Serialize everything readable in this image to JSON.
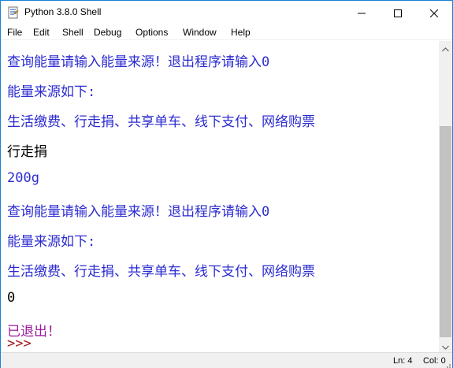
{
  "window": {
    "title": "Python 3.8.0 Shell"
  },
  "menu": {
    "items": [
      "File",
      "Edit",
      "Shell",
      "Debug",
      "Options",
      "Window",
      "Help"
    ]
  },
  "shell": {
    "lines": [
      {
        "text": "查询能量请输入能量来源！退出程序请输入0",
        "color": "#2b2bd1"
      },
      {
        "text": "能量来源如下:",
        "color": "#2b2bd1"
      },
      {
        "text": "生活缴费、行走捐、共享单车、线下支付、网络购票",
        "color": "#2b2bd1"
      },
      {
        "text": "行走捐",
        "color": "#000000"
      },
      {
        "text": "200g",
        "color": "#2b2bd1"
      },
      {
        "text": "查询能量请输入能量来源！退出程序请输入0",
        "color": "#2b2bd1"
      },
      {
        "text": "能量来源如下:",
        "color": "#2b2bd1"
      },
      {
        "text": "生活缴费、行走捐、共享单车、线下支付、网络购票",
        "color": "#2b2bd1"
      },
      {
        "text": "0",
        "color": "#000000"
      },
      {
        "text": "已退出！",
        "color": "#9a1a9a"
      }
    ],
    "prompt": ">>>"
  },
  "status": {
    "ln": "Ln: 4",
    "col": "Col: 0"
  },
  "icons": {
    "app": "python-idle-icon",
    "minimize": "minimize-icon",
    "maximize": "maximize-icon",
    "close": "close-icon",
    "scroll_up": "chevron-up-icon",
    "scroll_down": "chevron-down-icon",
    "grip": "resize-grip-icon"
  }
}
